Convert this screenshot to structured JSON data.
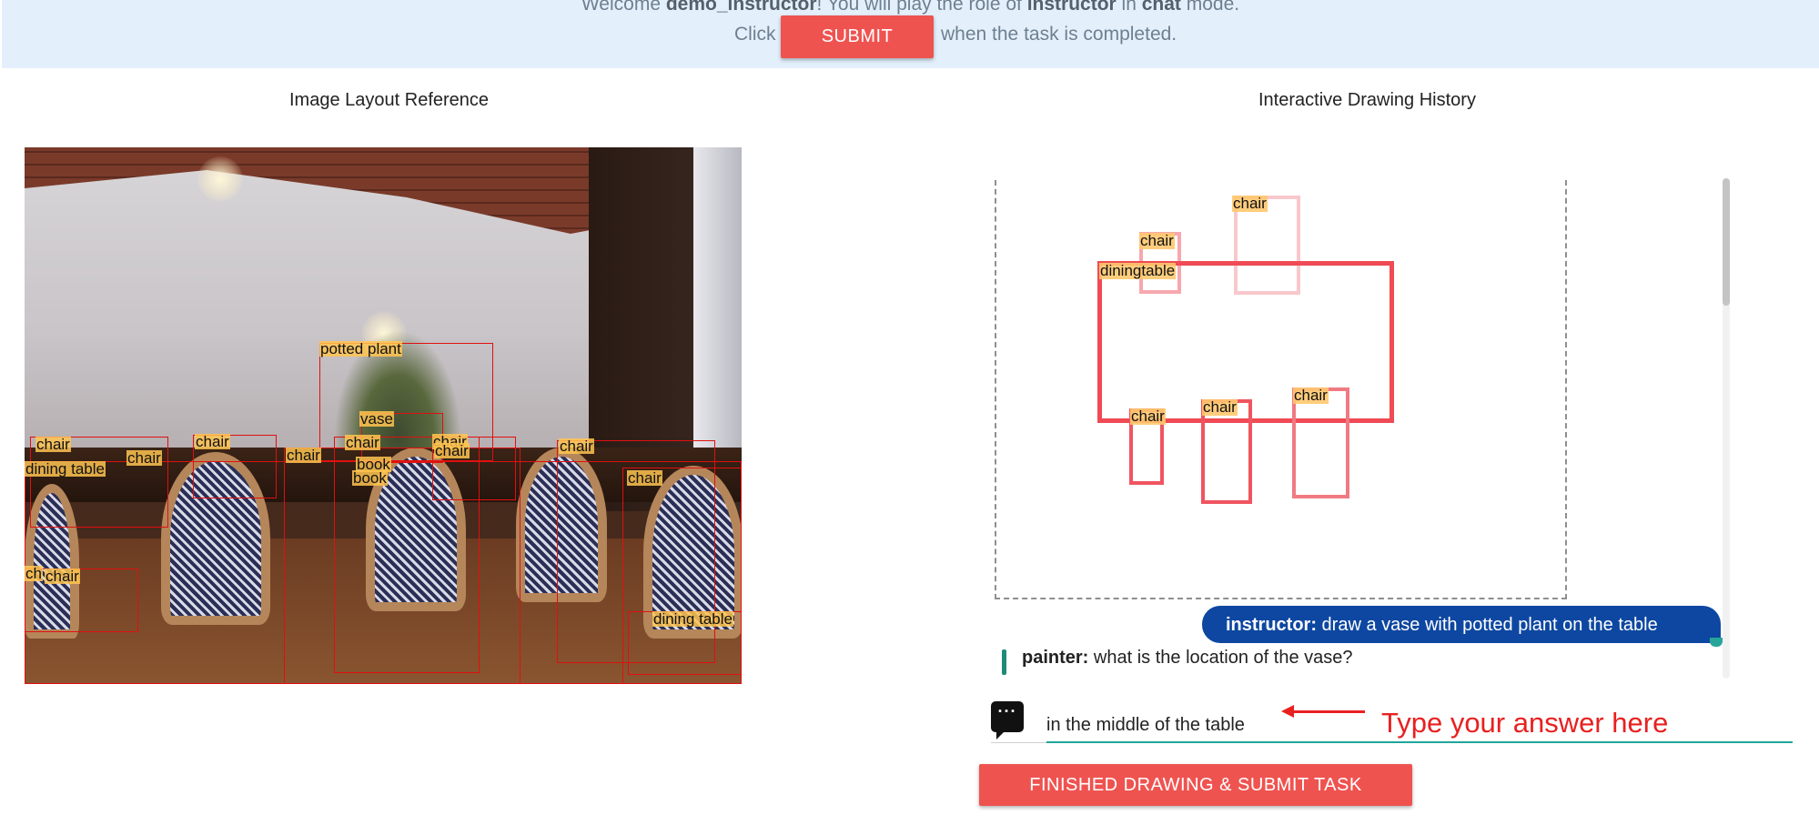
{
  "header": {
    "welcome_prefix": "Welcome ",
    "username": "demo_instructor",
    "welcome_mid": "! You will play the role of ",
    "role": "instructor",
    "welcome_in": " in ",
    "mode": "chat",
    "welcome_suffix": " mode.",
    "click_prefix": "Click",
    "submit_label": "SUBMIT",
    "click_suffix": "when the task is completed."
  },
  "left_panel": {
    "title": "Image Layout Reference",
    "labels": {
      "potted_plant": "potted plant",
      "vase": "vase",
      "chair": "chair",
      "dining_table": "dining table",
      "book": "book",
      "chair_truncated": "ch"
    }
  },
  "right_panel": {
    "title": "Interactive Drawing History",
    "drawing_labels": {
      "chair": "chair",
      "diningtable": "diningtable"
    }
  },
  "chat": {
    "instructor_name": "instructor:",
    "instructor_text": " draw a vase with potted plant on the table",
    "painter_name": "painter:",
    "painter_text": " what is the location of the vase?",
    "input_value": "in the middle of the table",
    "chat_icon": "chat-bubble-icon"
  },
  "annotation": {
    "hint": "Type your answer here",
    "color": "#e82020"
  },
  "footer": {
    "finish_label": "FINISHED DRAWING & SUBMIT TASK"
  },
  "colors": {
    "accent_button": "#ef5350",
    "instructor_bubble": "#0d47a1",
    "header_bg": "#e3f0fc",
    "input_underline": "#1ea79a"
  }
}
